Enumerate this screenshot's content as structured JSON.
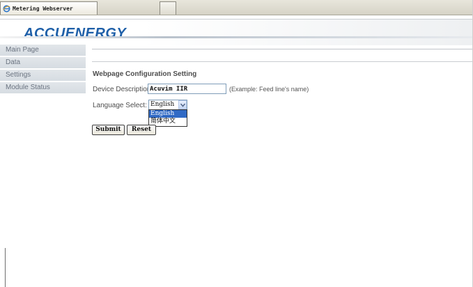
{
  "browser": {
    "tabs": [
      {
        "label": "Metering Webserver",
        "icon": "ie-browser-icon",
        "active": true
      },
      {
        "label": "",
        "active": false
      }
    ]
  },
  "header": {
    "logo_text": "ACCUENERGY",
    "logo_color": "#1e5fa8"
  },
  "sidebar": {
    "items": [
      {
        "label": "Main Page"
      },
      {
        "label": "Data"
      },
      {
        "label": "Settings"
      },
      {
        "label": "Module Status"
      }
    ]
  },
  "main": {
    "section_title": "Webpage Configuration Setting",
    "device_description": {
      "label": "Device Description:",
      "value": "Acuvim IIR",
      "hint": "(Example: Feed line's name)"
    },
    "language": {
      "label": "Language Select:",
      "selected": "English",
      "options": [
        "English",
        "简体中文"
      ],
      "highlighted_option": "English",
      "dropdown_open": true
    },
    "buttons": {
      "submit_label": "Submit",
      "reset_label": "Reset"
    }
  },
  "colors": {
    "nav_background": "#dde2e7",
    "nav_text": "#6a7380",
    "selection_highlight": "#316ac5"
  }
}
